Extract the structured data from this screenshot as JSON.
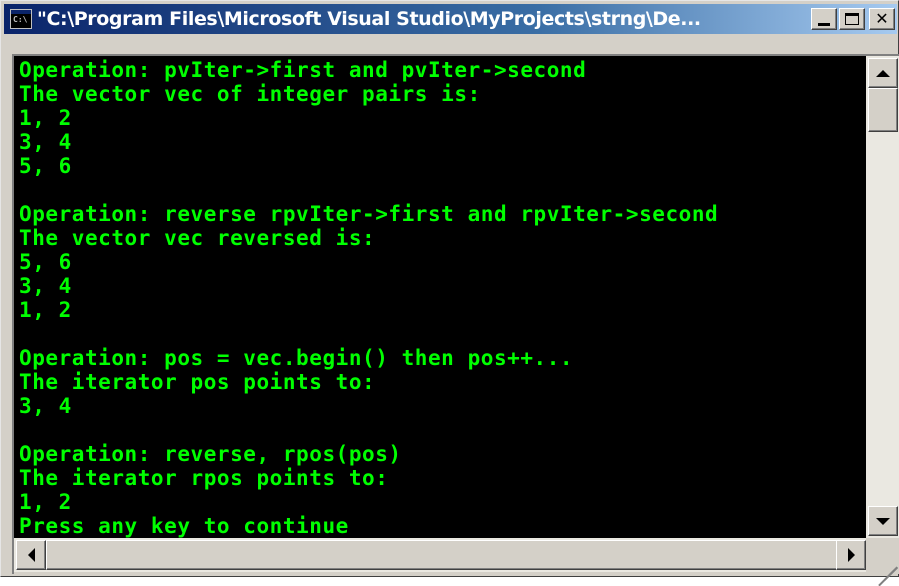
{
  "window": {
    "title": "\"C:\\Program Files\\Microsoft Visual Studio\\MyProjects\\strng\\De...",
    "icon": "console-icon",
    "icon_text": "C:\\"
  },
  "console": {
    "text_color": "#00ff00",
    "background": "#000000",
    "lines": [
      "Operation: pvIter->first and pvIter->second",
      "The vector vec of integer pairs is:",
      "1, 2",
      "3, 4",
      "5, 6",
      "",
      "Operation: reverse rpvIter->first and rpvIter->second",
      "The vector vec reversed is:",
      "5, 6",
      "3, 4",
      "1, 2",
      "",
      "Operation: pos = vec.begin() then pos++...",
      "The iterator pos points to:",
      "3, 4",
      "",
      "Operation: reverse, rpos(pos)",
      "The iterator rpos points to:",
      "1, 2",
      "Press any key to continue"
    ]
  }
}
